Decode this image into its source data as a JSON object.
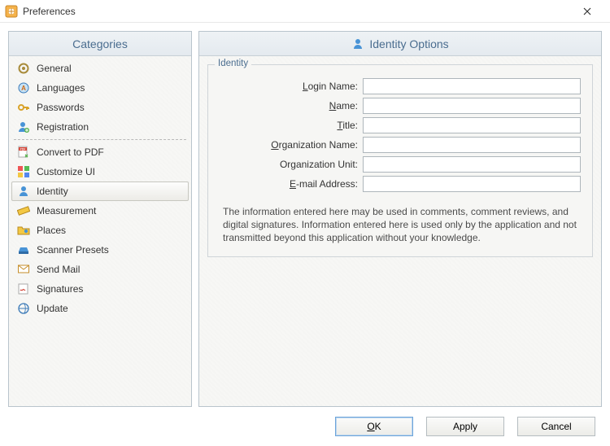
{
  "window": {
    "title": "Preferences"
  },
  "panels": {
    "categories_title": "Categories",
    "main_title": "Identity Options"
  },
  "categories": {
    "items": [
      {
        "label": "General"
      },
      {
        "label": "Languages"
      },
      {
        "label": "Passwords"
      },
      {
        "label": "Registration"
      },
      {
        "label": "Convert to PDF"
      },
      {
        "label": "Customize UI"
      },
      {
        "label": "Identity"
      },
      {
        "label": "Measurement"
      },
      {
        "label": "Places"
      },
      {
        "label": "Scanner Presets"
      },
      {
        "label": "Send Mail"
      },
      {
        "label": "Signatures"
      },
      {
        "label": "Update"
      }
    ],
    "selected_index": 6,
    "divider_after_index": 3
  },
  "identity": {
    "legend": "Identity",
    "rows": {
      "login_name": {
        "label_html": "<span class='ul'>L</span>ogin Name:",
        "value": ""
      },
      "name": {
        "label_html": "<span class='ul'>N</span>ame:",
        "value": ""
      },
      "title": {
        "label_html": "<span class='ul'>T</span>itle:",
        "value": ""
      },
      "org_name": {
        "label_html": "<span class='ul'>O</span>rganization Name:",
        "value": ""
      },
      "org_unit": {
        "label_html": "Organization Unit:",
        "value": ""
      },
      "email": {
        "label_html": "<span class='ul'>E</span>-mail Address:",
        "value": ""
      }
    },
    "description": "The information entered here may be used in comments, comment reviews, and digital signatures. Information entered here is used only by the application and not transmitted beyond this application without your knowledge."
  },
  "buttons": {
    "ok_html": "<span class='ul'>O</span>K",
    "apply_html": "Apply",
    "cancel_html": "Cancel"
  },
  "icons": {
    "general": "gear-icon",
    "languages": "globe-a-icon",
    "passwords": "key-icon",
    "registration": "user-plus-icon",
    "convert_to_pdf": "pdf-icon",
    "customize_ui": "palette-icon",
    "identity": "person-icon",
    "measurement": "ruler-icon",
    "places": "folder-pin-icon",
    "scanner_presets": "scanner-icon",
    "send_mail": "mail-icon",
    "signatures": "signature-icon",
    "update": "globe-refresh-icon"
  }
}
